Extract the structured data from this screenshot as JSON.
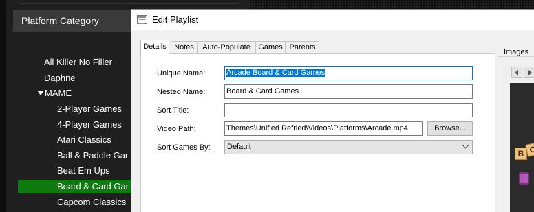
{
  "sidebar": {
    "header": "Platform Category",
    "items": [
      {
        "label": "All Killer No Filler"
      },
      {
        "label": "Daphne"
      },
      {
        "label": "MAME"
      },
      {
        "label": "2-Player Games"
      },
      {
        "label": "4-Player Games"
      },
      {
        "label": "Atari Classics"
      },
      {
        "label": "Ball & Paddle Gar"
      },
      {
        "label": "Beat Em Ups"
      },
      {
        "label": "Board & Card Gar"
      },
      {
        "label": "Capcom Classics"
      }
    ]
  },
  "dialog": {
    "title": "Edit Playlist",
    "tabs": [
      {
        "label": "Details"
      },
      {
        "label": "Notes"
      },
      {
        "label": "Auto-Populate"
      },
      {
        "label": "Games"
      },
      {
        "label": "Parents"
      }
    ],
    "active_tab": "Details",
    "fields": {
      "unique_name": {
        "label": "Unique Name:",
        "value": "Arcade Board & Card Games"
      },
      "nested_name": {
        "label": "Nested Name:",
        "value": "Board & Card Games"
      },
      "sort_title": {
        "label": "Sort Title:",
        "value": ""
      },
      "video_path": {
        "label": "Video Path:",
        "value": "Themes\\Unified Refried\\Videos\\Platforms\\Arcade.mp4"
      },
      "sort_games_by": {
        "label": "Sort Games By:",
        "value": "Default"
      }
    },
    "browse_label": "Browse...",
    "images_label": "Images",
    "preview_tiles": [
      "B",
      "C"
    ]
  },
  "colors": {
    "selection_green": "#0f7a0f",
    "text_selection": "#0078d7"
  }
}
